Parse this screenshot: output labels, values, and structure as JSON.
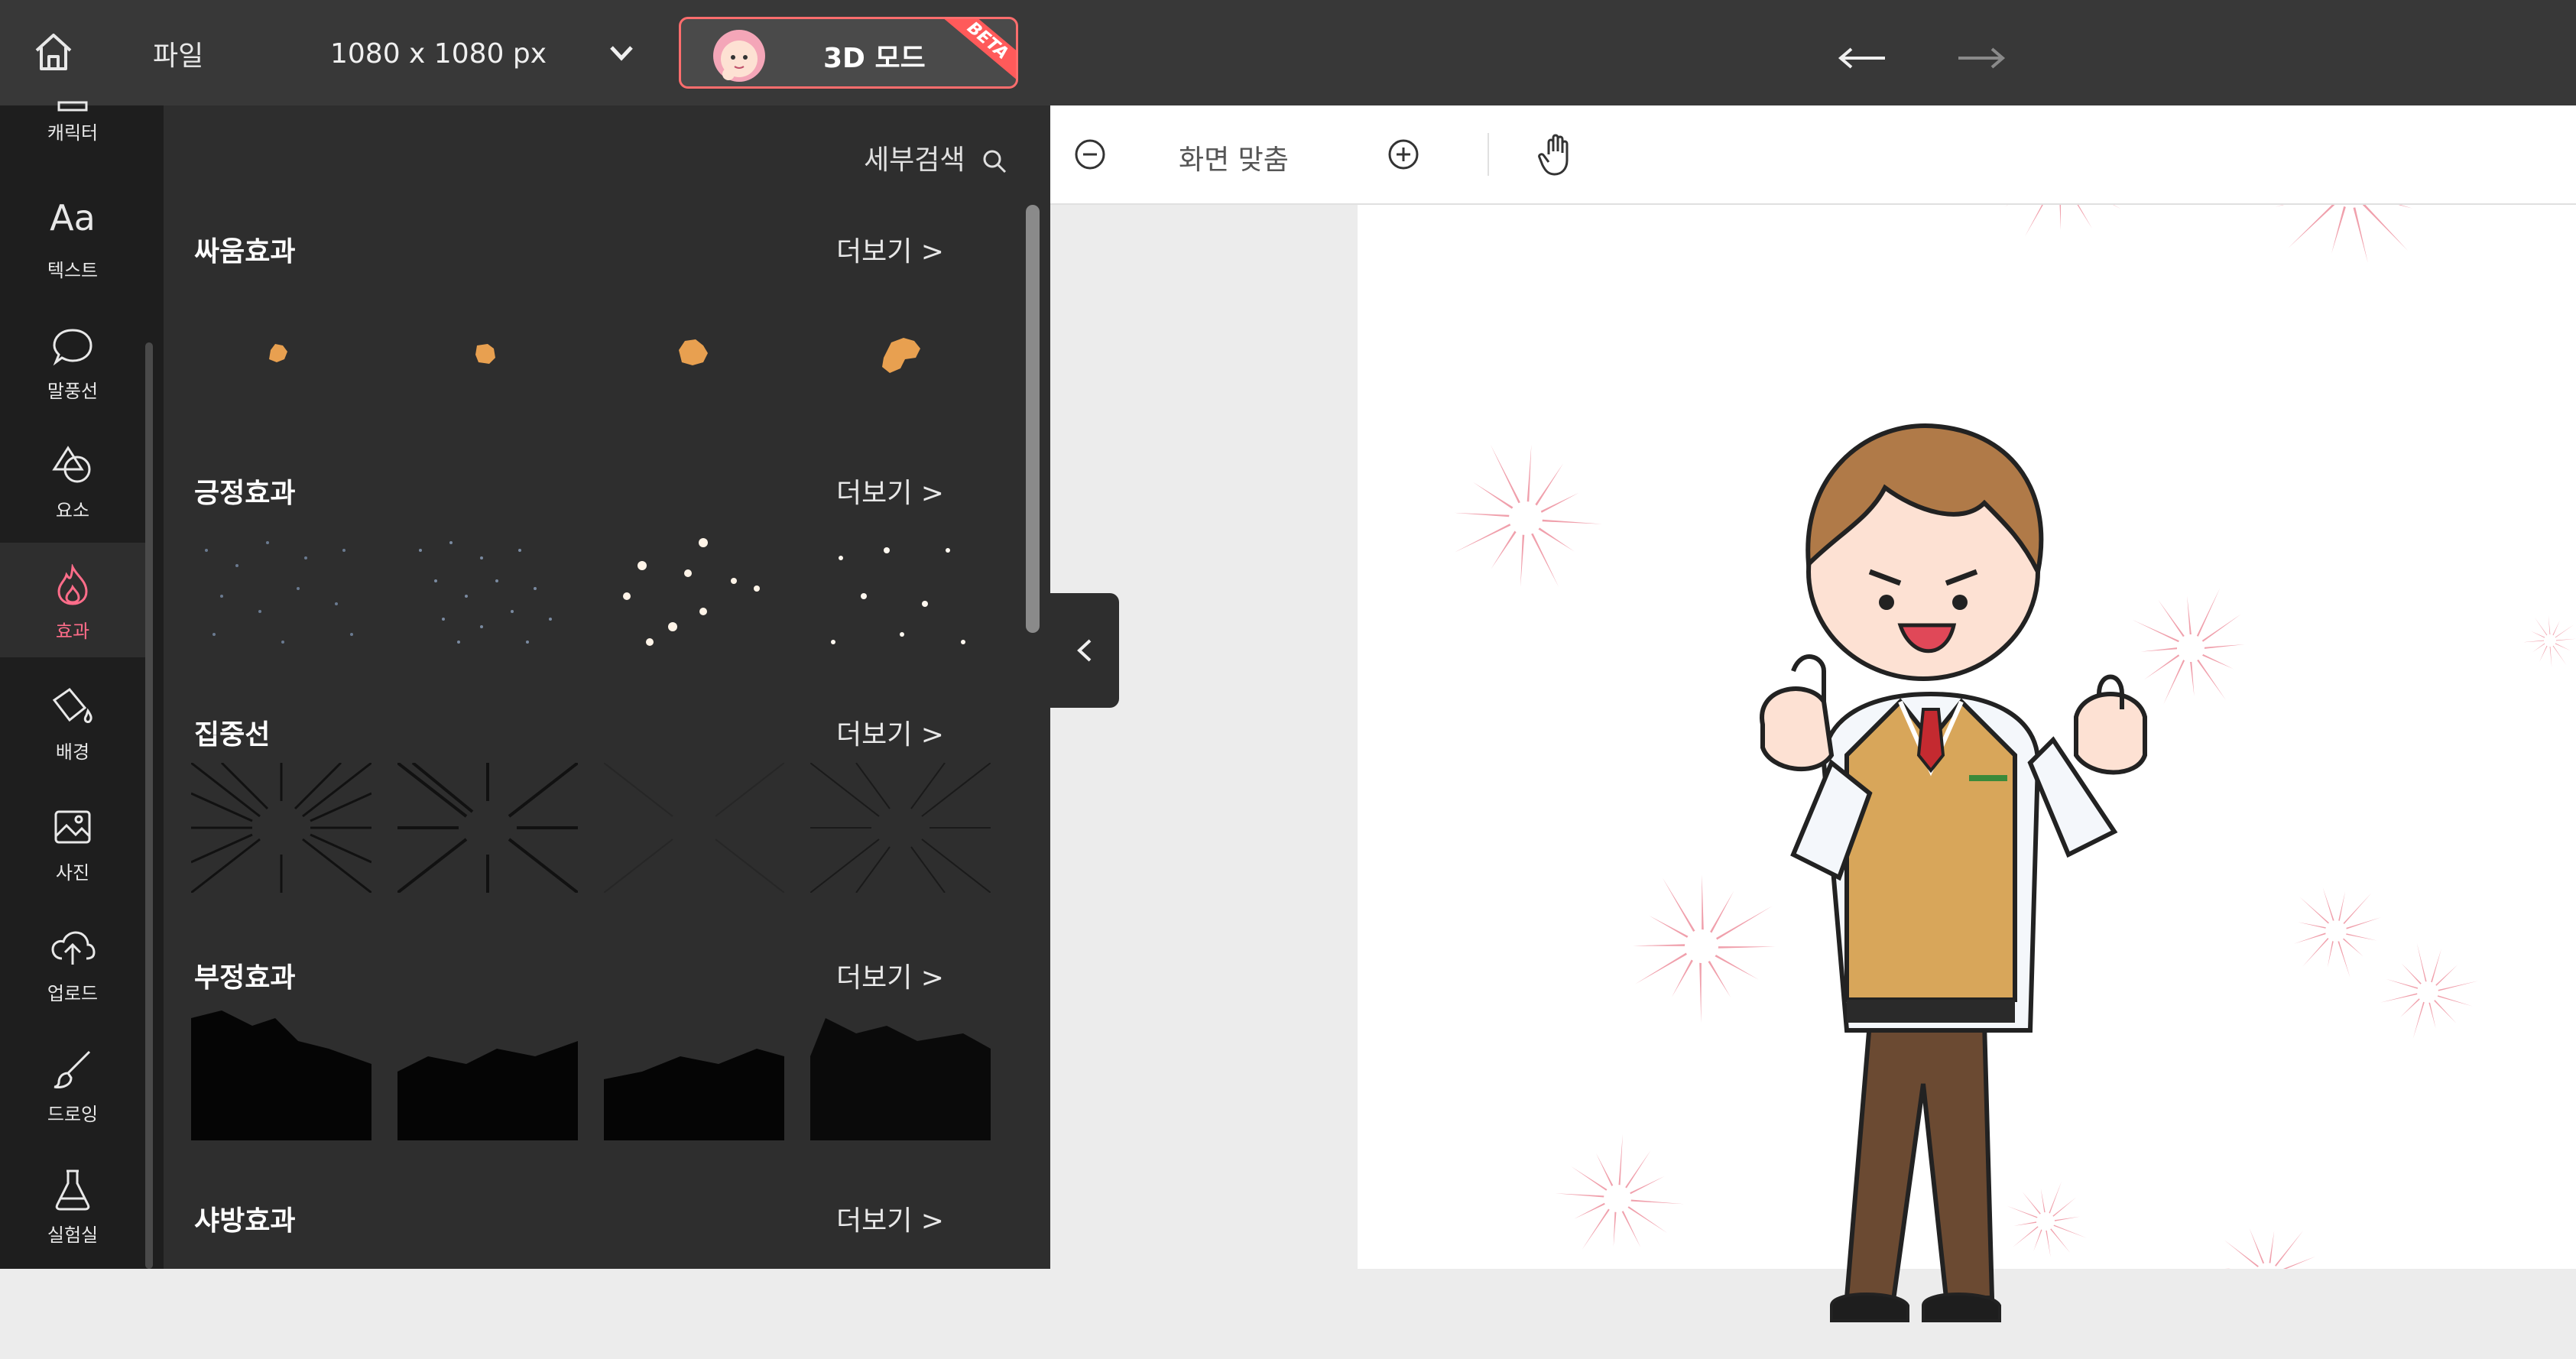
{
  "topbar": {
    "file_label": "파일",
    "canvas_size": "1080 x 1080 px",
    "mode_label": "3D 모드",
    "mode_badge": "BETA"
  },
  "rail": {
    "items": [
      {
        "label": "캐릭터",
        "icon": "character-icon"
      },
      {
        "label": "텍스트",
        "icon": "text-icon"
      },
      {
        "label": "말풍선",
        "icon": "speech-bubble-icon"
      },
      {
        "label": "요소",
        "icon": "shapes-icon"
      },
      {
        "label": "효과",
        "icon": "flame-icon",
        "active": true
      },
      {
        "label": "배경",
        "icon": "paint-bucket-icon"
      },
      {
        "label": "사진",
        "icon": "photo-icon"
      },
      {
        "label": "업로드",
        "icon": "cloud-upload-icon"
      },
      {
        "label": "드로잉",
        "icon": "brush-icon"
      },
      {
        "label": "실험실",
        "icon": "flask-icon"
      }
    ]
  },
  "panel": {
    "detail_search": "세부검색",
    "categories": [
      {
        "title": "싸움효과",
        "more": "더보기 >"
      },
      {
        "title": "긍정효과",
        "more": "더보기 >"
      },
      {
        "title": "집중선",
        "more": "더보기 >"
      },
      {
        "title": "부정효과",
        "more": "더보기 >"
      },
      {
        "title": "샤방효과",
        "more": "더보기 >"
      }
    ]
  },
  "toolbar": {
    "fit_label": "화면 맞춤"
  },
  "colors": {
    "accent": "#ff6d8a",
    "topbar": "#383838",
    "rail": "#1e1e1e",
    "panel": "#2e2e2e",
    "fight_effect": "#e8a050",
    "burst": "#f0a0ac"
  }
}
